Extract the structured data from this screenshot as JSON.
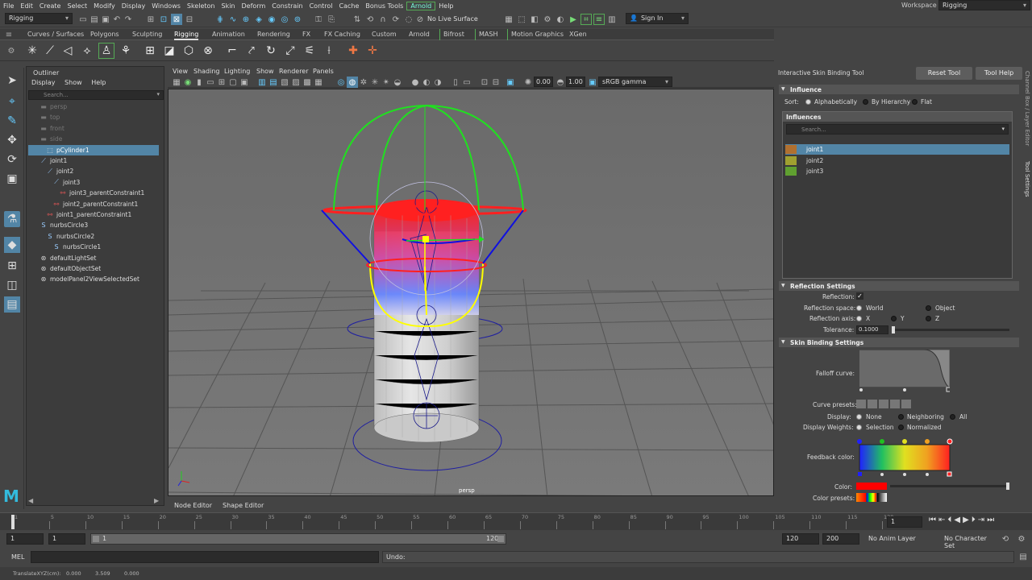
{
  "menubar": {
    "items": [
      "File",
      "Edit",
      "Create",
      "Select",
      "Modify",
      "Display",
      "Windows",
      "Skeleton",
      "Skin",
      "Deform",
      "Constrain",
      "Control",
      "Cache",
      "Bonus Tools",
      "Arnold",
      "Help"
    ],
    "workspace_label": "Workspace :",
    "workspace_value": "Rigging"
  },
  "statusline": {
    "mode_menu": "Rigging",
    "live_surface": "No Live Surface",
    "sign_in": "Sign In"
  },
  "shelf": {
    "tabs": [
      "Curves / Surfaces",
      "Polygons",
      "Sculpting",
      "Rigging",
      "Animation",
      "Rendering",
      "FX",
      "FX Caching",
      "Custom",
      "Arnold",
      "Bifrost",
      "MASH",
      "Motion Graphics",
      "XGen"
    ],
    "active_tab": "Rigging"
  },
  "outliner": {
    "title": "Outliner",
    "menu": [
      "Display",
      "Show",
      "Help"
    ],
    "search_placeholder": "Search...",
    "items": [
      {
        "label": "persp",
        "indent": 0,
        "dim": true
      },
      {
        "label": "top",
        "indent": 0,
        "dim": true
      },
      {
        "label": "front",
        "indent": 0,
        "dim": true
      },
      {
        "label": "side",
        "indent": 0,
        "dim": true
      },
      {
        "label": "pCylinder1",
        "indent": 0,
        "selected": true
      },
      {
        "label": "joint1",
        "indent": 0
      },
      {
        "label": "joint2",
        "indent": 1
      },
      {
        "label": "joint3",
        "indent": 2
      },
      {
        "label": "joint3_parentConstraint1",
        "indent": 3
      },
      {
        "label": "joint2_parentConstraint1",
        "indent": 2
      },
      {
        "label": "joint1_parentConstraint1",
        "indent": 1
      },
      {
        "label": "nurbsCircle3",
        "indent": 0
      },
      {
        "label": "nurbsCircle2",
        "indent": 1
      },
      {
        "label": "nurbsCircle1",
        "indent": 2
      },
      {
        "label": "defaultLightSet",
        "indent": 0
      },
      {
        "label": "defaultObjectSet",
        "indent": 0
      },
      {
        "label": "modelPanel2ViewSelectedSet",
        "indent": 0
      }
    ]
  },
  "viewport": {
    "menu": [
      "View",
      "Shading",
      "Lighting",
      "Show",
      "Renderer",
      "Panels"
    ],
    "exposure": "0.00",
    "gamma": "1.00",
    "color_space": "sRGB gamma",
    "camera_label": "persp"
  },
  "tool_settings": {
    "title": "Interactive Skin Binding Tool",
    "reset_button": "Reset Tool",
    "help_button": "Tool Help",
    "influence_section": "Influence",
    "sort_label": "Sort:",
    "sort_options": [
      "Alphabetically",
      "By Hierarchy",
      "Flat"
    ],
    "influences_section": "Influences",
    "search_placeholder": "Search...",
    "influences": [
      {
        "name": "joint1",
        "color": "#b07030",
        "selected": true
      },
      {
        "name": "joint2",
        "color": "#a0a030"
      },
      {
        "name": "joint3",
        "color": "#60a030"
      }
    ],
    "reflection_section": "Reflection Settings",
    "reflection_label": "Reflection:",
    "reflection_space_label": "Reflection space:",
    "reflection_space_options": [
      "World",
      "Object"
    ],
    "reflection_axis_label": "Reflection axis:",
    "reflection_axis_options": [
      "X",
      "Y",
      "Z"
    ],
    "tolerance_label": "Tolerance:",
    "tolerance_value": "0.1000",
    "skin_section": "Skin Binding Settings",
    "falloff_label": "Falloff curve:",
    "curve_presets_label": "Curve presets:",
    "display_label": "Display:",
    "display_options": [
      "None",
      "Neighboring",
      "All"
    ],
    "display_weights_label": "Display Weights:",
    "display_weights_options": [
      "Selection",
      "Normalized"
    ],
    "feedback_label": "Feedback color:",
    "color_label": "Color:",
    "color_presets_label": "Color presets:",
    "side_tabs": [
      "Channel Box / Layer Editor",
      "Tool Settings"
    ]
  },
  "bottom_tabs": [
    "Node Editor",
    "Shape Editor"
  ],
  "time_slider": {
    "ticks": [
      "1",
      "5",
      "10",
      "15",
      "20",
      "25",
      "30",
      "35",
      "40",
      "45",
      "50",
      "55",
      "60",
      "65",
      "70",
      "75",
      "80",
      "85",
      "90",
      "95",
      "100",
      "105",
      "110",
      "115",
      "120"
    ],
    "current_frame": "1"
  },
  "range_slider": {
    "start": "1",
    "inner_start": "1",
    "range_start_label": "1",
    "range_end_label": "120",
    "end": "120",
    "out_end": "200",
    "anim_layer": "No Anim Layer",
    "character_set": "No Character Set"
  },
  "command_line": {
    "lang": "MEL",
    "result_label": "Undo:"
  },
  "help_line": {
    "label": "TranslateXYZ(cm):",
    "x": "0.000",
    "y": "3.509",
    "z": "0.000"
  }
}
